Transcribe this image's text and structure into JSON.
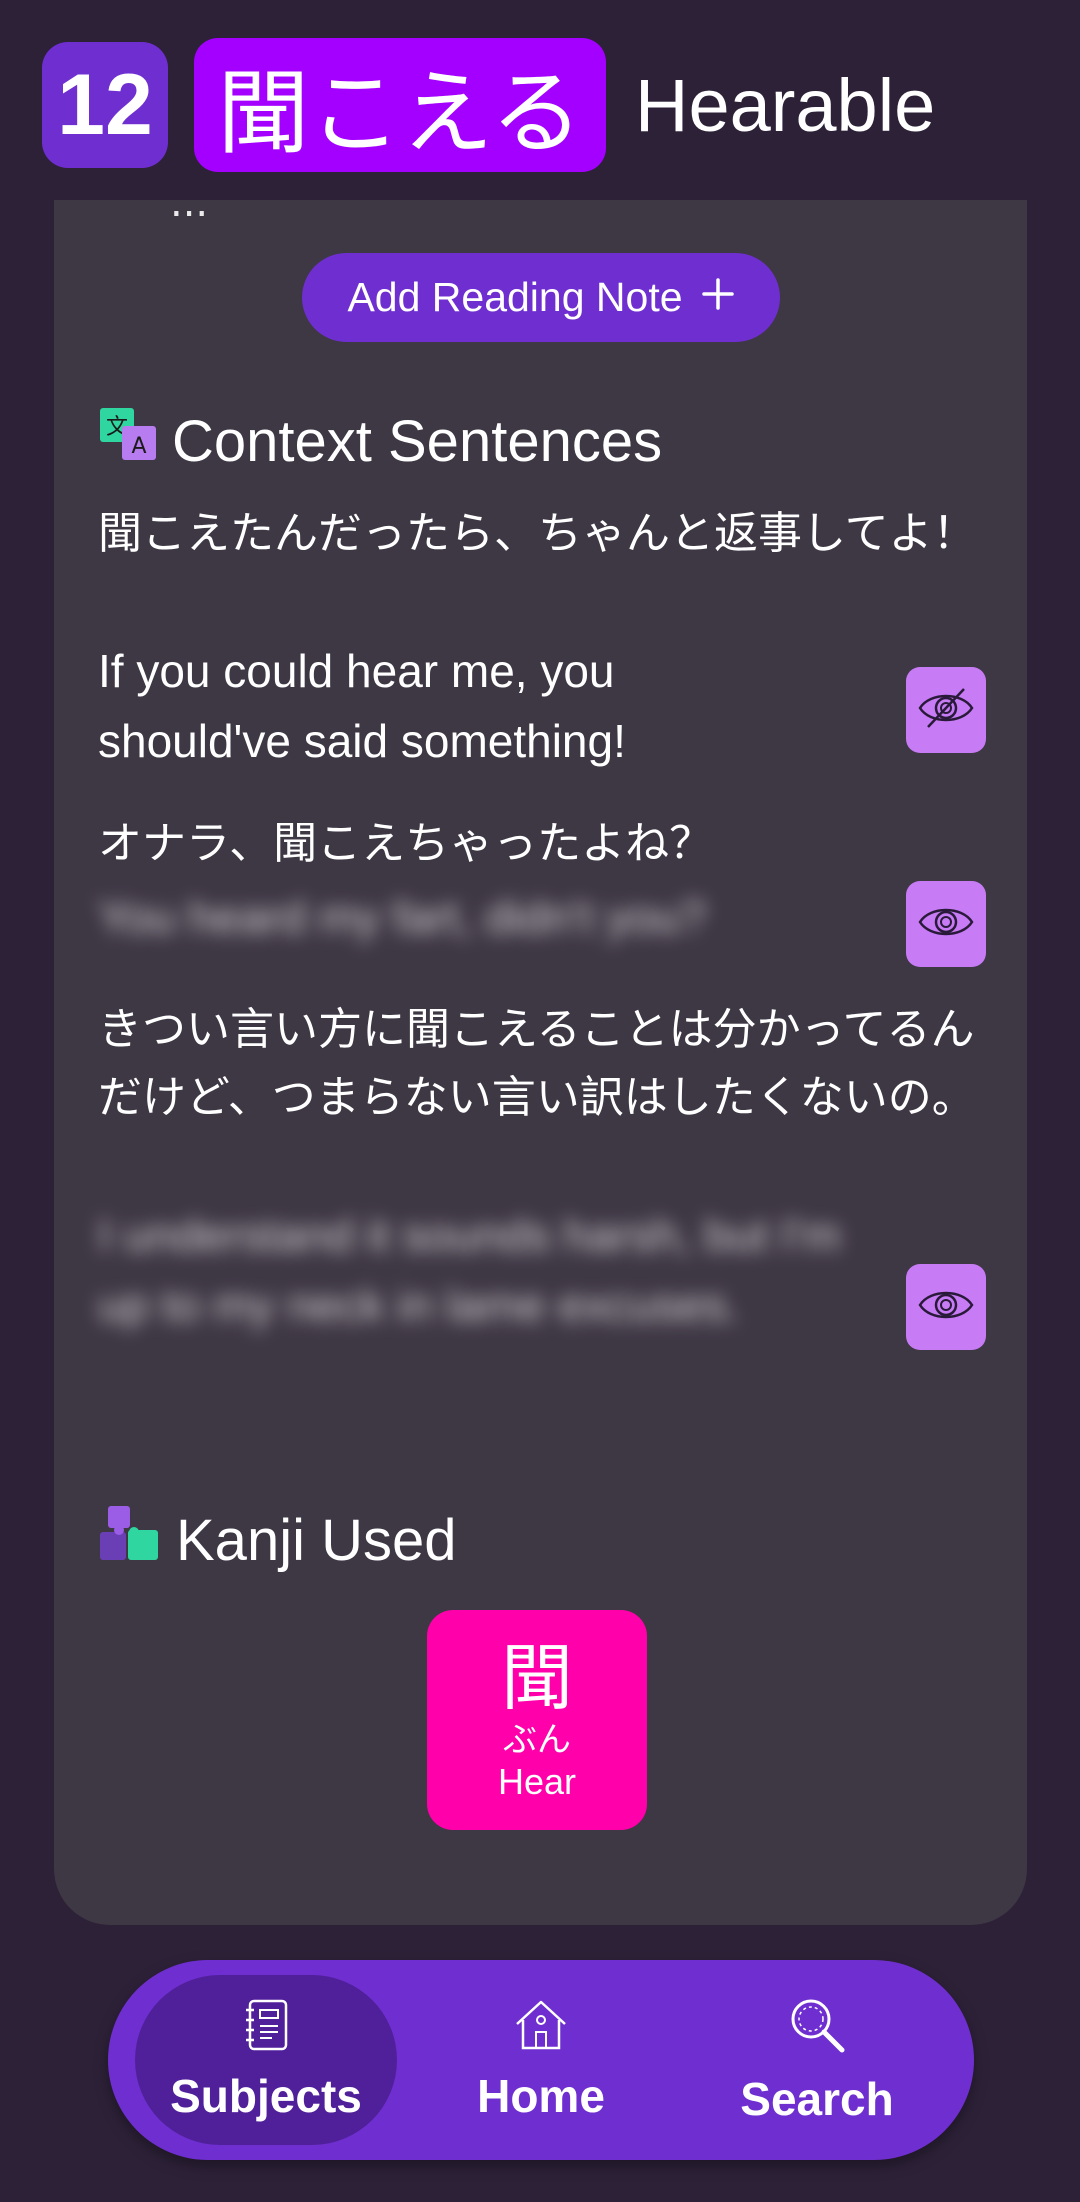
{
  "header": {
    "level": "12",
    "vocab": "聞こえる",
    "meaning": "Hearable"
  },
  "card_cutoff_text": "...",
  "add_reading_note": {
    "label": "Add Reading Note",
    "icon": "plus-icon"
  },
  "context_sentences": {
    "title": "Context Sentences",
    "icon": "translate-icon",
    "items": [
      {
        "jp": "聞こえたんだったら、ちゃんと返事してよ！",
        "en": "If you could hear me, you should've said something!",
        "revealed": true
      },
      {
        "jp": "オナラ、聞こえちゃったよね？",
        "en": "You heard my fart, didn't you?",
        "revealed": false
      },
      {
        "jp": "きつい言い方に聞こえることは分かってるんだけど、つまらない言い訳はしたくないの。",
        "en": "I understand it sounds harsh, but I'm up to my neck in lame excuses.",
        "revealed": false
      }
    ]
  },
  "kanji_used": {
    "title": "Kanji Used",
    "icon": "puzzle-icon",
    "items": [
      {
        "character": "聞",
        "reading": "ぶん",
        "meaning": "Hear",
        "color": "#ff00aa"
      }
    ]
  },
  "nav": {
    "items": [
      {
        "label": "Subjects",
        "icon": "notebook-icon",
        "active": true
      },
      {
        "label": "Home",
        "icon": "house-icon",
        "active": false
      },
      {
        "label": "Search",
        "icon": "magnifier-icon",
        "active": false
      }
    ]
  },
  "colors": {
    "background": "#2d2138",
    "card": "#3e3744",
    "accent_purple": "#6f2fd0",
    "vocab_purple": "#a400ff",
    "eye_button": "#c77bf5",
    "kanji_pink": "#ff00aa"
  }
}
